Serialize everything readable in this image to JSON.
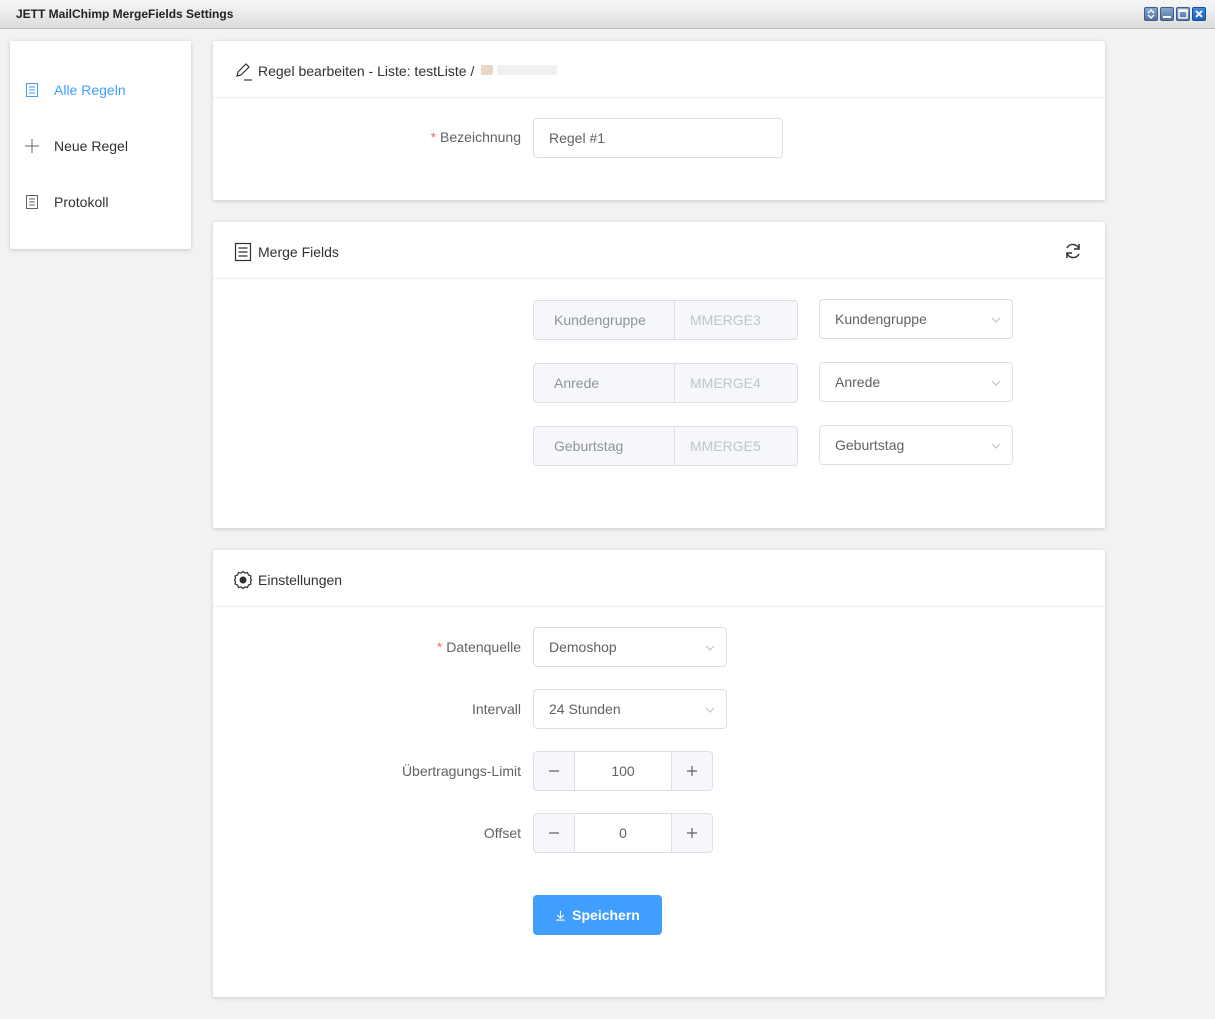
{
  "window": {
    "title": "JETT MailChimp MergeFields Settings",
    "buttons": [
      "restore",
      "minimize",
      "maximize",
      "close"
    ]
  },
  "sidebar": {
    "items": [
      {
        "label": "Alle Regeln",
        "icon": "document-icon",
        "active": true
      },
      {
        "label": "Neue Regel",
        "icon": "plus-icon",
        "active": false
      },
      {
        "label": "Protokoll",
        "icon": "document-icon",
        "active": false
      }
    ]
  },
  "rule_card": {
    "title": "Regel bearbeiten - Liste: testListe /",
    "icon": "edit-icon",
    "name_label": "Bezeichnung",
    "name_value": "Regel #1"
  },
  "merge_card": {
    "title": "Merge Fields",
    "icon": "document-icon",
    "refresh_icon": "refresh-icon",
    "fields": [
      {
        "name": "Kundengruppe",
        "tag": "MMERGE3",
        "selected": "Kundengruppe"
      },
      {
        "name": "Anrede",
        "tag": "MMERGE4",
        "selected": "Anrede"
      },
      {
        "name": "Geburtstag",
        "tag": "MMERGE5",
        "selected": "Geburtstag"
      }
    ]
  },
  "settings_card": {
    "title": "Einstellungen",
    "icon": "settings-icon",
    "datasource_label": "Datenquelle",
    "datasource_value": "Demoshop",
    "interval_label": "Intervall",
    "interval_value": "24 Stunden",
    "limit_label": "Übertragungs-Limit",
    "limit_value": "100",
    "offset_label": "Offset",
    "offset_value": "0",
    "save_label": "Speichern"
  },
  "colors": {
    "accent": "#409eff",
    "required": "#f56c6c"
  }
}
